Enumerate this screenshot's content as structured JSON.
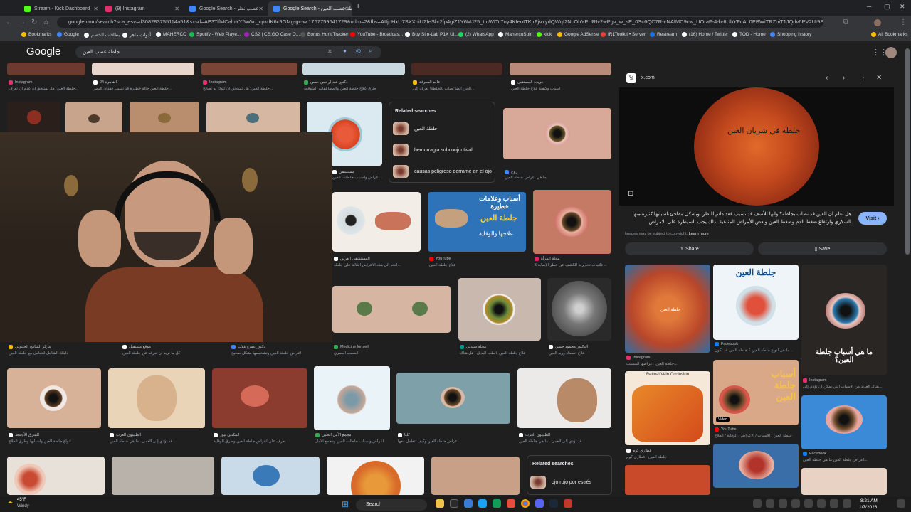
{
  "browser": {
    "tabs": [
      {
        "label": "Stream - Kick Dashboard",
        "color": "#53fc18"
      },
      {
        "label": "(9) Instagram",
        "color": "#e1306c"
      },
      {
        "label": "Google Search - عصب نظر",
        "color": "#4285f4"
      },
      {
        "label": "Google Search - جلطة عصب العين",
        "color": "#4285f4"
      }
    ],
    "url": "google.com/search?sca_esv=d308283755114a51&sxsrf=AE3TifMCalhYY5Wkc_cpkdK6c9GMg-gc-w:1767759641729&udm=2&fbs=AIIjpHxU7SXXniUZfeShr2fp4giZ1Y6MJ25_tmWITc7uy4KIeoITKjrFjVxydQWqI2NcOhYPURIv2wPgv_w_sE_0Sc6QC7R-cNAfMC9cw_UOraF-4-b-6UhYFcAL0PBWiTRZoiT1JQdv6PV2Ut9SmhyZiIo...",
    "bookmarks": [
      "Bookmarks",
      "Google",
      "بطاقات الخصم",
      "أدوات ماهر",
      "MAHERCO",
      "Spotify - Web Playe...",
      "CS2 | CS:GO Case O...",
      "Bonus Hunt Tracker",
      "YouTube - Broadcas...",
      "Buy Sim-Lab P1X Ul...",
      "(2) WhatsApp",
      "MahercoSpin",
      "kick",
      "Google AdSense",
      "IRLToolkit • Server",
      "Restream",
      "(16) Home / Twitter",
      "TOD - Home",
      "Shopping history",
      "All Bookmarks"
    ]
  },
  "google": {
    "logo": "Google",
    "query": "جلطة عصب العين"
  },
  "grid": {
    "row1_captions": [
      {
        "src": "Instagram",
        "title": "جلطة العين: هل تستحق أن عدم ان تعرف..."
      },
      {
        "src": "القاهرة 24",
        "title": "جلطة العين حالة خطيرة قد تسبب فقدان البصر..."
      },
      {
        "src": "Instagram",
        "title": "جلطة العين: هل تستحق أن تتوك له نصائح..."
      },
      {
        "src": "دكتور عبدالرحمن حسن",
        "title": "طرق علاج جلطة العين والمضاعفات المتوقعة"
      },
      {
        "src": "عالم المعرفة",
        "title": "العين ايضاً تصاب بالجلطة! تعرف إلى..."
      },
      {
        "src": "جريدة المستقبل",
        "title": "أسباب وكيفية علاج جلطة العين"
      }
    ],
    "row2_sources": [
      "مستشفى",
      "روح"
    ],
    "row2_titles": [
      "أعراض وأسباب جلطات العين...",
      "ما هي أعراض جلطة العين"
    ],
    "row3_captions": [
      {
        "src": "المستشفى العربي",
        "title": "اتجه إلى هذه الأعراض الثلاثة على جلطة..."
      },
      {
        "src": "YouTube",
        "title": "علاج جلطة العين"
      },
      {
        "src": "مجلة المرأة",
        "title": "5 علامات تحذيرية للكشف عن خطر الإصابة..."
      }
    ],
    "row4_captions": [
      {
        "src": "مركز الشامخ الجينولي",
        "title": "دليلك الشامل للتعامل مع جلطة العين"
      },
      {
        "src": "موقع مستقبل",
        "title": "كل ما تريد أن تعرفه عن جلطة العين"
      },
      {
        "src": "دكتور عمرو غلاب",
        "title": "أعراض جلطة العين وتشخيصها بشكل صحيح"
      },
      {
        "src": "Medicine for sell",
        "title": "العصب البصري"
      },
      {
        "src": "مجلة سيدتي",
        "title": "علاج جلطة العين بالطب البديل | هل هناك"
      },
      {
        "src": "الدكتور محمود حسن",
        "title": "علاج انسداد وريد العين"
      }
    ],
    "row5_captions": [
      {
        "src": "الشرق الأوسط",
        "title": "أنواع جلطة العين وأسبابها وطرق العلاج"
      },
      {
        "src": "الطبيبون العرب",
        "title": "قد تؤدي إلى العمى.. ما هي جلطة العين"
      },
      {
        "src": "المكتبي نيوز",
        "title": "تعرف على أعراض جلطة العين وطرق الوقاية"
      },
      {
        "src": "مجمع الأمل الطبي",
        "title": "أعراض وأسباب جلطات العين ومجمع الأمل"
      },
      {
        "src": "كلنا",
        "title": "أعراض جلطة العين وكيف تتعامل معها"
      },
      {
        "src": "الطبيبون العرب",
        "title": "قد تؤدي إلى العمى.. ما هي جلطة العين"
      }
    ]
  },
  "related1": {
    "title": "Related searches",
    "items": [
      "جلطة العين",
      "hemorragia subconjuntival",
      "causas peligroso derrame en el ojo"
    ]
  },
  "related2": {
    "title": "Related searches",
    "items": [
      "ojo rojo por estrés"
    ]
  },
  "panel": {
    "site": "x.com",
    "image_text": "جلطة في شريان العين",
    "description": "هل تعلم ان العين قد تصاب بجلطة؟ وانها للأسف قد تسبب فقد دائم للنظر، وبشكل مفاجئ،اسبابها كثيرة منها السكري وارتفاع ضغط الدم وضغط العين وبعض الأمراض المناعية لذلك يجب السيطرة على الامراض",
    "visit_label": "Visit",
    "copyright": "Images may be subject to copyright.",
    "learn_more": "Learn more",
    "share_label": "Share",
    "save_label": "Save",
    "thumb_tiles": [
      {
        "label": "جلطة العين"
      },
      {
        "label": "جلطة العين"
      },
      {
        "label": "ما هي أسباب جلطة العين؟"
      },
      {
        "label": "Retinal Vein Occlusion"
      },
      {
        "label": "أسباب جلطة العين"
      }
    ],
    "thumb_captions": [
      {
        "src": "Facebook",
        "title": "ما هي أنواع جلطة العين ؟ جلطة العين قد تكون..."
      },
      {
        "src": "Instagram",
        "title": "جلطة العين: أعراضها المسبب..."
      },
      {
        "src": "Instagram",
        "title": "هناك العديد من الأسباب التي يمكن أن تؤدي إلى..."
      },
      {
        "src": "YouTube",
        "title": "جلطة العين : الأسباب / الأعراض / الوقاية / العلاج"
      },
      {
        "src": "فطاري كوم",
        "title": "جلطة العين - فطاري كوم"
      },
      {
        "src": "Facebook",
        "title": "أعراض جلطة العين ما هي جلطة العين..."
      }
    ],
    "video_badge": "Video"
  },
  "taskbar": {
    "weather_temp": "45°F",
    "weather_text": "Windy",
    "search_label": "Search",
    "time": "8:21 AM",
    "date": "1/7/2026"
  }
}
